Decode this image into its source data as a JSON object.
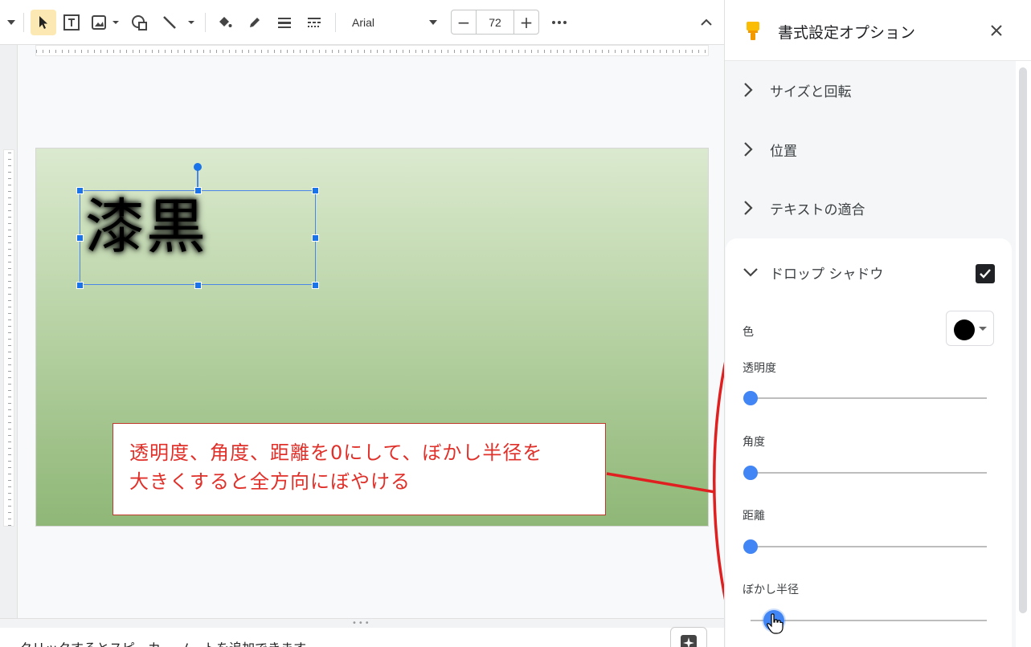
{
  "toolbar": {
    "font_name": "Arial",
    "font_size": "72",
    "decrease_label": "−",
    "increase_label": "+"
  },
  "slide": {
    "text": "漆黒",
    "callout_line1": "透明度、角度、距離を0にして、ぼかし半径を",
    "callout_line2": "大きくすると全方向にぼやける",
    "callout_color": "#e0302a"
  },
  "notes": {
    "placeholder": "クリックするとスピーカー ノートを追加できます"
  },
  "panel": {
    "title": "書式設定オプション",
    "sections": [
      {
        "label": "サイズと回転",
        "expanded": false
      },
      {
        "label": "位置",
        "expanded": false
      },
      {
        "label": "テキストの適合",
        "expanded": false
      },
      {
        "label": "ドロップ シャドウ",
        "expanded": true,
        "checked": true
      }
    ],
    "shadow": {
      "color_label": "色",
      "color_value": "#000000",
      "transparency_label": "透明度",
      "transparency_value": 0,
      "angle_label": "角度",
      "angle_value": 0,
      "distance_label": "距離",
      "distance_value": 0,
      "blur_label": "ぼかし半径",
      "blur_value": 0.1
    }
  }
}
